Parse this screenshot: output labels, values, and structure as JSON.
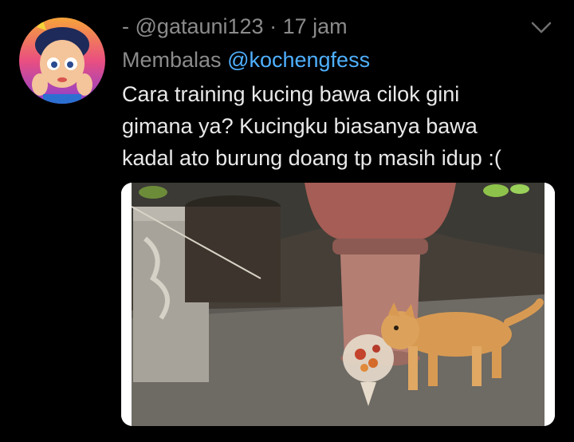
{
  "tweet": {
    "author_name": "-",
    "handle": "@gatauni123",
    "separator": "·",
    "timestamp": "17 jam",
    "reply_prefix": "Membalas",
    "reply_to": "@kochengfess",
    "body_lines": [
      "Cara training kucing bawa cilok gini",
      "gimana ya? Kucingku biasanya bawa",
      "kadal ato burung doang tp masih idup :("
    ],
    "media": {
      "icon": "photo-cat-carrying-bag"
    }
  },
  "colors": {
    "background": "#000000",
    "secondary_text": "#8b8b8b",
    "mention": "#4fb0ff",
    "primary_text": "#e9e9e9"
  }
}
